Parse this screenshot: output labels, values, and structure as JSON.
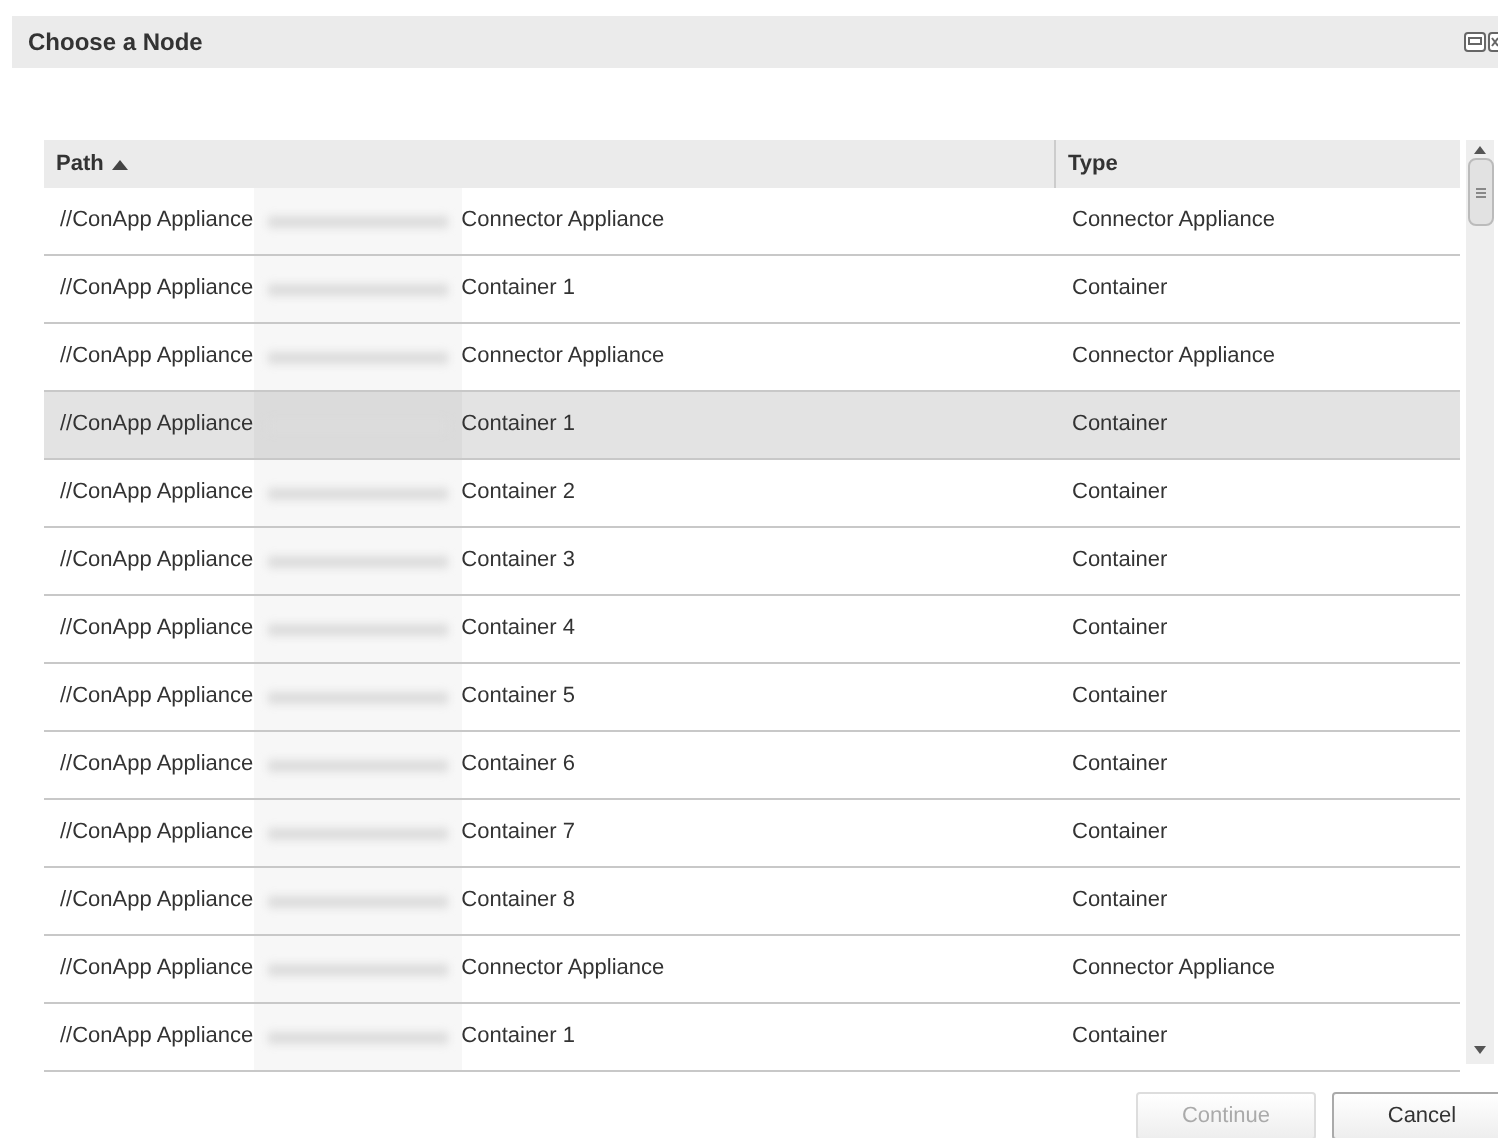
{
  "dialog": {
    "title": "Choose a Node"
  },
  "table": {
    "columns": [
      {
        "label": "Path",
        "sorted": true
      },
      {
        "label": "Type",
        "sorted": false
      }
    ],
    "rows": [
      {
        "path_prefix": "//ConApp Appliance",
        "path_suffix": "Connector Appliance",
        "type": "Connector Appliance",
        "selected": false
      },
      {
        "path_prefix": "//ConApp Appliance",
        "path_suffix": "Container 1",
        "type": "Container",
        "selected": false
      },
      {
        "path_prefix": "//ConApp Appliance",
        "path_suffix": "Connector Appliance",
        "type": "Connector Appliance",
        "selected": false
      },
      {
        "path_prefix": "//ConApp Appliance",
        "path_suffix": "Container 1",
        "type": "Container",
        "selected": true
      },
      {
        "path_prefix": "//ConApp Appliance",
        "path_suffix": "Container 2",
        "type": "Container",
        "selected": false
      },
      {
        "path_prefix": "//ConApp Appliance",
        "path_suffix": "Container 3",
        "type": "Container",
        "selected": false
      },
      {
        "path_prefix": "//ConApp Appliance",
        "path_suffix": "Container 4",
        "type": "Container",
        "selected": false
      },
      {
        "path_prefix": "//ConApp Appliance",
        "path_suffix": "Container 5",
        "type": "Container",
        "selected": false
      },
      {
        "path_prefix": "//ConApp Appliance",
        "path_suffix": "Container 6",
        "type": "Container",
        "selected": false
      },
      {
        "path_prefix": "//ConApp Appliance",
        "path_suffix": "Container 7",
        "type": "Container",
        "selected": false
      },
      {
        "path_prefix": "//ConApp Appliance",
        "path_suffix": "Container 8",
        "type": "Container",
        "selected": false
      },
      {
        "path_prefix": "//ConApp Appliance",
        "path_suffix": "Connector Appliance",
        "type": "Connector Appliance",
        "selected": false
      },
      {
        "path_prefix": "//ConApp Appliance",
        "path_suffix": "Container 1",
        "type": "Container",
        "selected": false
      }
    ]
  },
  "buttons": [
    {
      "label": "Continue",
      "disabled": true
    },
    {
      "label": "Cancel",
      "disabled": false
    }
  ]
}
